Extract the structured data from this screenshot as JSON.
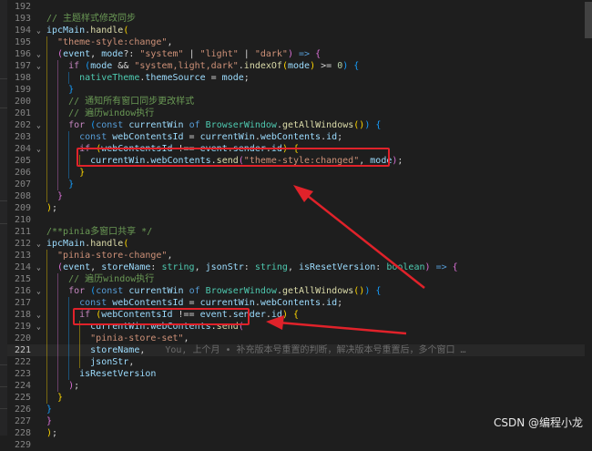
{
  "editor": {
    "lines": [
      {
        "n": "192",
        "segs": []
      },
      {
        "n": "193",
        "segs": [
          [
            "cm",
            "// 主题样式修改同步"
          ]
        ]
      },
      {
        "n": "194",
        "fold": "⌄",
        "segs": [
          [
            "var",
            "ipcMain"
          ],
          [
            "p",
            "."
          ],
          [
            "fn",
            "handle"
          ],
          [
            "b1",
            "("
          ]
        ]
      },
      {
        "n": "195",
        "segs": [
          [
            "str",
            "\"theme-style:change\""
          ],
          [
            "p",
            ","
          ]
        ]
      },
      {
        "n": "196",
        "fold": "⌄",
        "segs": [
          [
            "b2",
            "("
          ],
          [
            "var",
            "event"
          ],
          [
            "p",
            ", "
          ],
          [
            "var",
            "mode"
          ],
          [
            "p",
            "?: "
          ],
          [
            "str",
            "\"system\""
          ],
          [
            "p",
            " | "
          ],
          [
            "str",
            "\"light\""
          ],
          [
            "p",
            " | "
          ],
          [
            "str",
            "\"dark\""
          ],
          [
            "b2",
            ")"
          ],
          [
            "p",
            " "
          ],
          [
            "kw",
            "=>"
          ],
          [
            "p",
            " "
          ],
          [
            "b2",
            "{"
          ]
        ]
      },
      {
        "n": "197",
        "fold": "⌄",
        "segs": [
          [
            "ctl",
            "if"
          ],
          [
            "p",
            " "
          ],
          [
            "b3",
            "("
          ],
          [
            "var",
            "mode"
          ],
          [
            "p",
            " && "
          ],
          [
            "str",
            "\"system,light,dark\""
          ],
          [
            "p",
            "."
          ],
          [
            "fn",
            "indexOf"
          ],
          [
            "b1",
            "("
          ],
          [
            "var",
            "mode"
          ],
          [
            "b1",
            ")"
          ],
          [
            "p",
            " >= "
          ],
          [
            "num",
            "0"
          ],
          [
            "b3",
            ")"
          ],
          [
            "p",
            " "
          ],
          [
            "b3",
            "{"
          ]
        ]
      },
      {
        "n": "198",
        "segs": [
          [
            "cls",
            "nativeTheme"
          ],
          [
            "p",
            "."
          ],
          [
            "var",
            "themeSource"
          ],
          [
            "p",
            " = "
          ],
          [
            "var",
            "mode"
          ],
          [
            "p",
            ";"
          ]
        ]
      },
      {
        "n": "199",
        "segs": [
          [
            "b3",
            "}"
          ]
        ]
      },
      {
        "n": "200",
        "segs": [
          [
            "cm",
            "// 通知所有窗口同步更改样式"
          ]
        ]
      },
      {
        "n": "201",
        "segs": [
          [
            "cm",
            "// 遍历window执行"
          ]
        ]
      },
      {
        "n": "202",
        "fold": "⌄",
        "segs": [
          [
            "ctl",
            "for"
          ],
          [
            "p",
            " "
          ],
          [
            "b3",
            "("
          ],
          [
            "kw",
            "const"
          ],
          [
            "p",
            " "
          ],
          [
            "var",
            "currentWin"
          ],
          [
            "p",
            " "
          ],
          [
            "kw",
            "of"
          ],
          [
            "p",
            " "
          ],
          [
            "cls",
            "BrowserWindow"
          ],
          [
            "p",
            "."
          ],
          [
            "fn",
            "getAllWindows"
          ],
          [
            "b1",
            "()"
          ],
          [
            "b3",
            ")"
          ],
          [
            "p",
            " "
          ],
          [
            "b3",
            "{"
          ]
        ]
      },
      {
        "n": "203",
        "segs": [
          [
            "kw",
            "const"
          ],
          [
            "p",
            " "
          ],
          [
            "var",
            "webContentsId"
          ],
          [
            "p",
            " = "
          ],
          [
            "var",
            "currentWin"
          ],
          [
            "p",
            "."
          ],
          [
            "var",
            "webContents"
          ],
          [
            "p",
            "."
          ],
          [
            "var",
            "id"
          ],
          [
            "p",
            ";"
          ]
        ]
      },
      {
        "n": "204",
        "fold": "⌄",
        "segs": [
          [
            "ctl",
            "if"
          ],
          [
            "p",
            " "
          ],
          [
            "b1",
            "("
          ],
          [
            "var",
            "webContentsId"
          ],
          [
            "p",
            " !== "
          ],
          [
            "var",
            "event"
          ],
          [
            "p",
            "."
          ],
          [
            "var",
            "sender"
          ],
          [
            "p",
            "."
          ],
          [
            "var",
            "id"
          ],
          [
            "b1",
            ")"
          ],
          [
            "p",
            " "
          ],
          [
            "b1",
            "{"
          ]
        ]
      },
      {
        "n": "205",
        "segs": [
          [
            "var",
            "currentWin"
          ],
          [
            "p",
            "."
          ],
          [
            "var",
            "webContents"
          ],
          [
            "p",
            "."
          ],
          [
            "fn",
            "send"
          ],
          [
            "b2",
            "("
          ],
          [
            "str",
            "\"theme-style:changed\""
          ],
          [
            "p",
            ", "
          ],
          [
            "var",
            "mode"
          ],
          [
            "b2",
            ")"
          ],
          [
            "p",
            ";"
          ]
        ]
      },
      {
        "n": "206",
        "segs": [
          [
            "b1",
            "}"
          ]
        ]
      },
      {
        "n": "207",
        "segs": [
          [
            "b3",
            "}"
          ]
        ]
      },
      {
        "n": "208",
        "segs": [
          [
            "b2",
            "}"
          ]
        ]
      },
      {
        "n": "209",
        "segs": [
          [
            "b1",
            ")"
          ],
          [
            "p",
            ";"
          ]
        ]
      },
      {
        "n": "210",
        "segs": []
      },
      {
        "n": "211",
        "segs": [
          [
            "cm",
            "/**pinia多窗口共享 */"
          ]
        ]
      },
      {
        "n": "212",
        "fold": "⌄",
        "segs": [
          [
            "var",
            "ipcMain"
          ],
          [
            "p",
            "."
          ],
          [
            "fn",
            "handle"
          ],
          [
            "b1",
            "("
          ]
        ]
      },
      {
        "n": "213",
        "segs": [
          [
            "str",
            "\"pinia-store-change\""
          ],
          [
            "p",
            ","
          ]
        ]
      },
      {
        "n": "214",
        "fold": "⌄",
        "segs": [
          [
            "b2",
            "("
          ],
          [
            "var",
            "event"
          ],
          [
            "p",
            ", "
          ],
          [
            "var",
            "storeName"
          ],
          [
            "p",
            ": "
          ],
          [
            "cls",
            "string"
          ],
          [
            "p",
            ", "
          ],
          [
            "var",
            "jsonStr"
          ],
          [
            "p",
            ": "
          ],
          [
            "cls",
            "string"
          ],
          [
            "p",
            ", "
          ],
          [
            "var",
            "isResetVersion"
          ],
          [
            "p",
            ": "
          ],
          [
            "cls",
            "boolean"
          ],
          [
            "b2",
            ")"
          ],
          [
            "p",
            " "
          ],
          [
            "kw",
            "=>"
          ],
          [
            "p",
            " "
          ],
          [
            "b2",
            "{"
          ]
        ]
      },
      {
        "n": "215",
        "segs": [
          [
            "cm",
            "// 遍历window执行"
          ]
        ]
      },
      {
        "n": "216",
        "fold": "⌄",
        "segs": [
          [
            "ctl",
            "for"
          ],
          [
            "p",
            " "
          ],
          [
            "b3",
            "("
          ],
          [
            "kw",
            "const"
          ],
          [
            "p",
            " "
          ],
          [
            "var",
            "currentWin"
          ],
          [
            "p",
            " "
          ],
          [
            "kw",
            "of"
          ],
          [
            "p",
            " "
          ],
          [
            "cls",
            "BrowserWindow"
          ],
          [
            "p",
            "."
          ],
          [
            "fn",
            "getAllWindows"
          ],
          [
            "b1",
            "()"
          ],
          [
            "b3",
            ")"
          ],
          [
            "p",
            " "
          ],
          [
            "b3",
            "{"
          ]
        ]
      },
      {
        "n": "217",
        "segs": [
          [
            "kw",
            "const"
          ],
          [
            "p",
            " "
          ],
          [
            "var",
            "webContentsId"
          ],
          [
            "p",
            " = "
          ],
          [
            "var",
            "currentWin"
          ],
          [
            "p",
            "."
          ],
          [
            "var",
            "webContents"
          ],
          [
            "p",
            "."
          ],
          [
            "var",
            "id"
          ],
          [
            "p",
            ";"
          ]
        ]
      },
      {
        "n": "218",
        "fold": "⌄",
        "segs": [
          [
            "ctl",
            "if"
          ],
          [
            "p",
            " "
          ],
          [
            "b1",
            "("
          ],
          [
            "var",
            "webContentsId"
          ],
          [
            "p",
            " !== "
          ],
          [
            "var",
            "event"
          ],
          [
            "p",
            "."
          ],
          [
            "var",
            "sender"
          ],
          [
            "p",
            "."
          ],
          [
            "var",
            "id"
          ],
          [
            "b1",
            ")"
          ],
          [
            "p",
            " "
          ],
          [
            "b1",
            "{"
          ]
        ]
      },
      {
        "n": "219",
        "fold": "⌄",
        "segs": [
          [
            "var",
            "currentWin"
          ],
          [
            "p",
            "."
          ],
          [
            "var",
            "webContents"
          ],
          [
            "p",
            "."
          ],
          [
            "fn",
            "send"
          ],
          [
            "b2",
            "("
          ]
        ]
      },
      {
        "n": "220",
        "segs": [
          [
            "str",
            "\"pinia-store-set\""
          ],
          [
            "p",
            ","
          ]
        ]
      },
      {
        "n": "221",
        "segs": [
          [
            "var",
            "storeName"
          ],
          [
            "p",
            ","
          ]
        ],
        "blame": "You, 上个月 • 补充版本号重置的判断，解决版本号重置后，多个窗口 …"
      },
      {
        "n": "222",
        "segs": [
          [
            "var",
            "jsonStr"
          ],
          [
            "p",
            ","
          ]
        ]
      },
      {
        "n": "223",
        "segs": [
          [
            "var",
            "isResetVersion"
          ]
        ]
      },
      {
        "n": "224",
        "segs": [
          [
            "b2",
            ")"
          ],
          [
            "p",
            ";"
          ]
        ]
      },
      {
        "n": "225",
        "segs": [
          [
            "b1",
            "}"
          ]
        ]
      },
      {
        "n": "226",
        "segs": [
          [
            "b3",
            "}"
          ]
        ]
      },
      {
        "n": "227",
        "segs": [
          [
            "b2",
            "}"
          ]
        ]
      },
      {
        "n": "228",
        "segs": [
          [
            "b1",
            ")"
          ],
          [
            "p",
            ";"
          ]
        ]
      },
      {
        "n": "229",
        "segs": []
      }
    ]
  },
  "watermark": "CSDN @编程小龙",
  "colors": {
    "highlight_box": "#e0222a",
    "background": "#1e1e1e"
  }
}
